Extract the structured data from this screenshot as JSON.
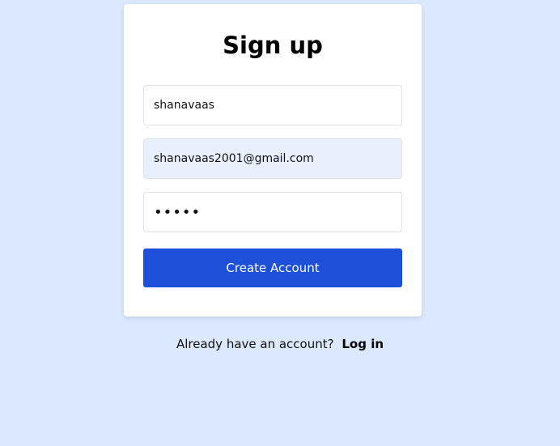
{
  "form": {
    "title": "Sign up",
    "username_value": "shanavaas",
    "email_value": "shanavaas2001@gmail.com",
    "password_value": "•••••",
    "submit_label": "Create Account"
  },
  "footer": {
    "prompt": "Already have an account?",
    "login_label": "Log in"
  },
  "colors": {
    "background": "#dbe8fe",
    "card": "#ffffff",
    "primary_button": "#1d4fd8",
    "autofill_field": "#e8f0fe"
  }
}
